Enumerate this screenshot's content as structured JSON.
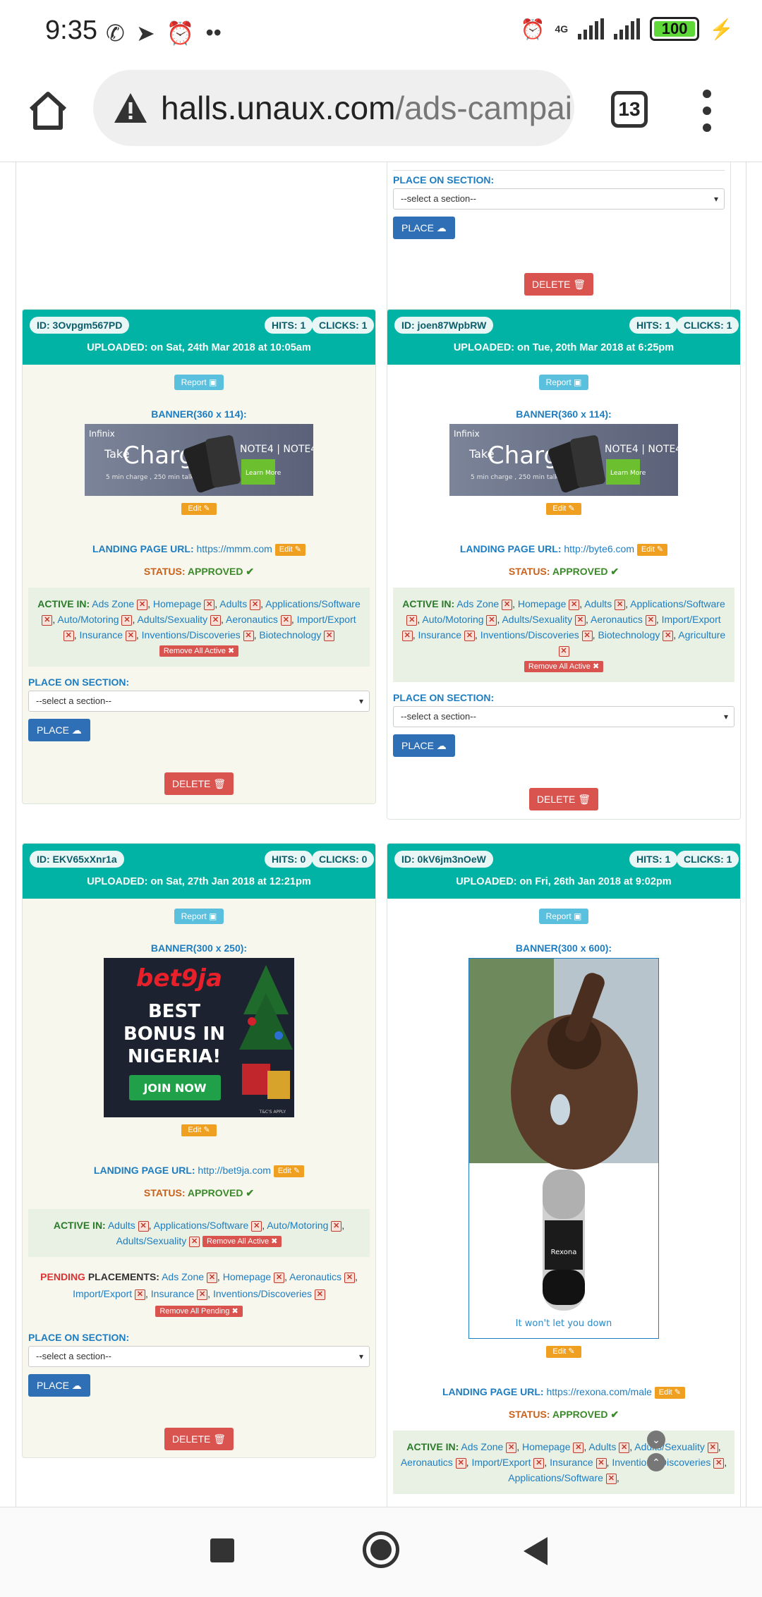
{
  "status_bar": {
    "time": "9:35",
    "network": "4G",
    "battery": "100"
  },
  "browser": {
    "url_host": "halls.unaux.com",
    "url_path": "/ads-campai",
    "tab_count": "13"
  },
  "top_card": {
    "place_label": "PLACE ON SECTION:",
    "select_placeholder": "--select a section--",
    "place_button": "PLACE",
    "delete_button": "DELETE"
  },
  "cards": [
    {
      "id": "ID: 3Ovpgm567PD",
      "hits": "HITS: 1",
      "clicks": "CLICKS: 1",
      "uploaded": "UPLOADED: on Sat, 24th Mar 2018 at 10:05am",
      "report": "Report",
      "banner_label": "BANNER(360 x 114):",
      "edit": "Edit",
      "landing_label": "LANDING PAGE URL:",
      "landing_url": "https://mmm.com",
      "status_label": "STATUS:",
      "status_value": "APPROVED ✔",
      "active_label": "ACTIVE IN:",
      "active": [
        "Ads Zone",
        "Homepage",
        "Adults",
        "Applications/Software",
        "Auto/Motoring",
        "Adults/Sexuality",
        "Aeronautics",
        "Import/Export",
        "Insurance",
        "Inventions/Discoveries",
        "Biotechnology"
      ],
      "remove_all_active": "Remove All Active ✖",
      "place_label": "PLACE ON SECTION:",
      "select_placeholder": "--select a section--",
      "place_button": "PLACE",
      "delete_button": "DELETE"
    },
    {
      "id": "ID: joen87WpbRW",
      "hits": "HITS: 1",
      "clicks": "CLICKS: 1",
      "uploaded": "UPLOADED: on Tue, 20th Mar 2018 at 6:25pm",
      "report": "Report",
      "banner_label": "BANNER(360 x 114):",
      "edit": "Edit",
      "landing_label": "LANDING PAGE URL:",
      "landing_url": "http://byte6.com",
      "status_label": "STATUS:",
      "status_value": "APPROVED ✔",
      "active_label": "ACTIVE IN:",
      "active": [
        "Ads Zone",
        "Homepage",
        "Adults",
        "Applications/Software",
        "Auto/Motoring",
        "Adults/Sexuality",
        "Aeronautics",
        "Import/Export",
        "Insurance",
        "Inventions/Discoveries",
        "Biotechnology",
        "Agriculture"
      ],
      "remove_all_active": "Remove All Active ✖",
      "place_label": "PLACE ON SECTION:",
      "select_placeholder": "--select a section--",
      "place_button": "PLACE",
      "delete_button": "DELETE"
    },
    {
      "id": "ID: EKV65xXnr1a",
      "hits": "HITS: 0",
      "clicks": "CLICKS: 0",
      "uploaded": "UPLOADED: on Sat, 27th Jan 2018 at 12:21pm",
      "report": "Report",
      "banner_label": "BANNER(300 x 250):",
      "edit": "Edit",
      "landing_label": "LANDING PAGE URL:",
      "landing_url": "http://bet9ja.com",
      "status_label": "STATUS:",
      "status_value": "APPROVED ✔",
      "active_label": "ACTIVE IN:",
      "active": [
        "Adults",
        "Applications/Software",
        "Auto/Motoring",
        "Adults/Sexuality"
      ],
      "remove_all_active": "Remove All Active ✖",
      "pending_label": "PENDING",
      "pending_label2": "PLACEMENTS:",
      "pending": [
        "Ads Zone",
        "Homepage",
        "Aeronautics",
        "Import/Export",
        "Insurance",
        "Inventions/Discoveries"
      ],
      "remove_all_pending": "Remove All Pending ✖",
      "place_label": "PLACE ON SECTION:",
      "select_placeholder": "--select a section--",
      "place_button": "PLACE",
      "delete_button": "DELETE"
    },
    {
      "id": "ID: 0kV6jm3nOeW",
      "hits": "HITS: 1",
      "clicks": "CLICKS: 1",
      "uploaded": "UPLOADED: on Fri, 26th Jan 2018 at 9:02pm",
      "report": "Report",
      "banner_label": "BANNER(300 x 600):",
      "edit": "Edit",
      "landing_label": "LANDING PAGE URL:",
      "landing_url": "https://rexona.com/male",
      "status_label": "STATUS:",
      "status_value": "APPROVED ✔",
      "active_label": "ACTIVE IN:",
      "active": [
        "Ads Zone",
        "Homepage",
        "Adults",
        "Adults/Sexuality",
        "Aeronautics",
        "Import/Export",
        "Insurance",
        "Inventions/Discoveries",
        "Applications/Software"
      ]
    }
  ],
  "banners": {
    "infinix": {
      "brand": "Infinix",
      "line1": "Take",
      "line2": "Charge",
      "model": "NOTE4 | NOTE4",
      "sub": "5 min charge , 250 min talk",
      "cta": "Learn More"
    },
    "bet9ja": {
      "brand": "bet9ja",
      "line1": "BEST",
      "line2": "BONUS IN",
      "line3": "NIGERIA!",
      "cta": "JOIN NOW",
      "fine": "T&C'S APPLY"
    },
    "rexona": {
      "brand": "Rexona",
      "tagline": "It won't let you down"
    }
  },
  "colors": {
    "teal": "#00b3a4",
    "blue": "#2f6fb6",
    "red": "#d9534f",
    "orange": "#f0a020",
    "link": "#1e7dc1"
  }
}
